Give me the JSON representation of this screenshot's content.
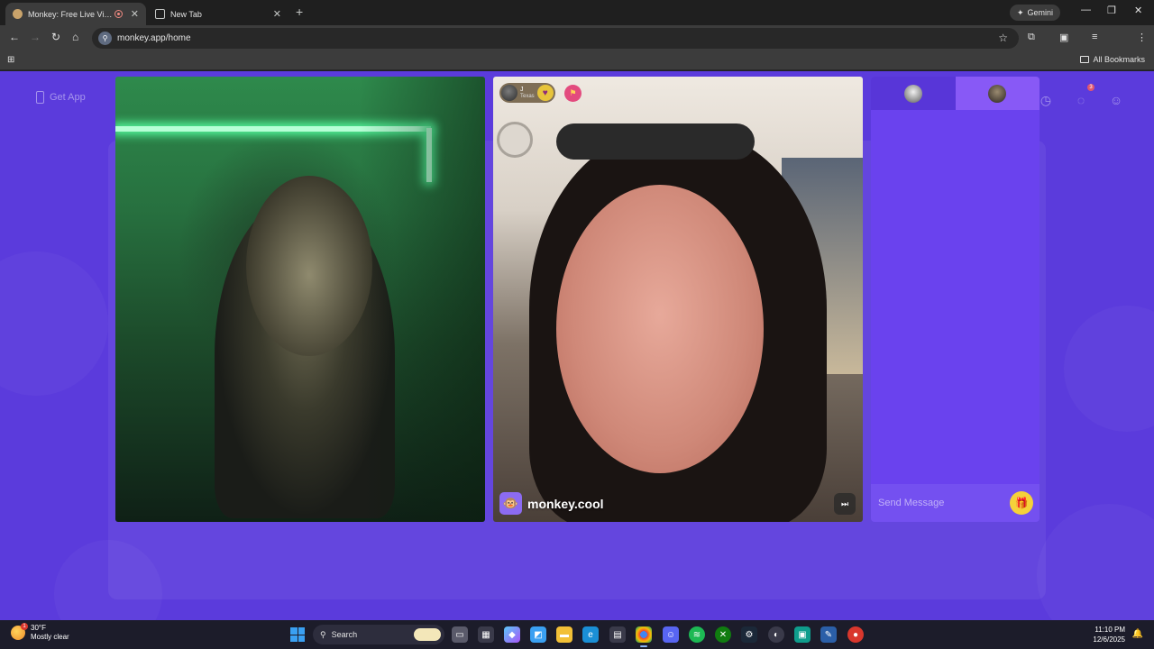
{
  "browser": {
    "tabs": [
      {
        "title": "Monkey: Free Live Video Ch",
        "active": true
      },
      {
        "title": "New Tab",
        "active": false
      }
    ],
    "gemini_label": "Gemini",
    "url": "monkey.app/home",
    "bookmarks_label": "All Bookmarks"
  },
  "page": {
    "get_app_label": "Get App",
    "notification_count": "3",
    "left_video": {
      "icon": "webcam-self"
    },
    "right_video": {
      "user_initial": "J",
      "user_location": "Texas",
      "watermark": "monkey.cool"
    },
    "chat": {
      "placeholder": "Send Message"
    }
  },
  "taskbar": {
    "weather_temp": "30°F",
    "weather_desc": "Mostly clear",
    "weather_badge": "1",
    "search_label": "Search",
    "time": "11:10 PM",
    "date": "12/6/2025"
  },
  "colors": {
    "page_bg": "#5b3bdc",
    "chat_bg": "#6a42ee",
    "gift": "#f5d13a"
  }
}
